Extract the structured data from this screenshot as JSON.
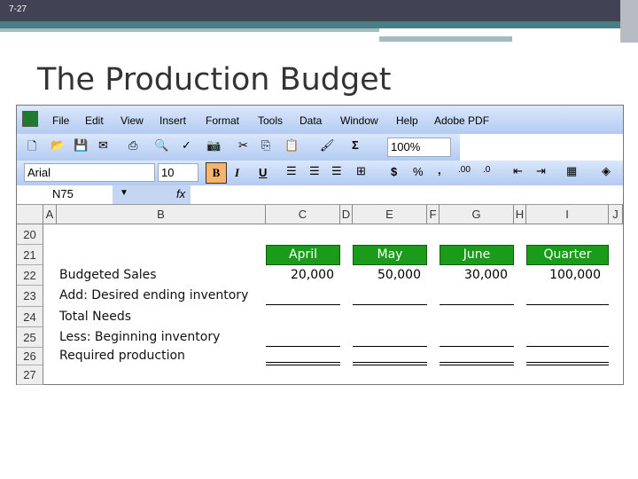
{
  "slide": {
    "number": "7-27",
    "title": "The Production Budget"
  },
  "menu": [
    "File",
    "Edit",
    "View",
    "Insert",
    "Format",
    "Tools",
    "Data",
    "Window",
    "Help",
    "Adobe PDF"
  ],
  "toolbar": {
    "zoom": "100%",
    "sum": "Σ",
    "font": "Arial",
    "size": "10",
    "bold": "B",
    "italic": "I",
    "underline": "U",
    "currency": "$",
    "percent": "%",
    "comma": ","
  },
  "formula_bar": {
    "name_box": "N75",
    "fx": "fx",
    "value": ""
  },
  "columns": [
    "A",
    "B",
    "C",
    "D",
    "E",
    "F",
    "G",
    "H",
    "I",
    "J"
  ],
  "rows": [
    "20",
    "21",
    "22",
    "23",
    "24",
    "25",
    "26",
    "27"
  ],
  "headers": [
    "April",
    "May",
    "June",
    "Quarter"
  ],
  "labels": [
    "Budgeted Sales",
    "Add: Desired ending inventory",
    "Total Needs",
    "Less: Beginning inventory",
    "Required production"
  ],
  "sales": [
    "20,000",
    "50,000",
    "30,000",
    "100,000"
  ],
  "colors": {
    "header_green": "#1a9c1a",
    "slide_bar": "#414254",
    "teal": "#497f84"
  }
}
